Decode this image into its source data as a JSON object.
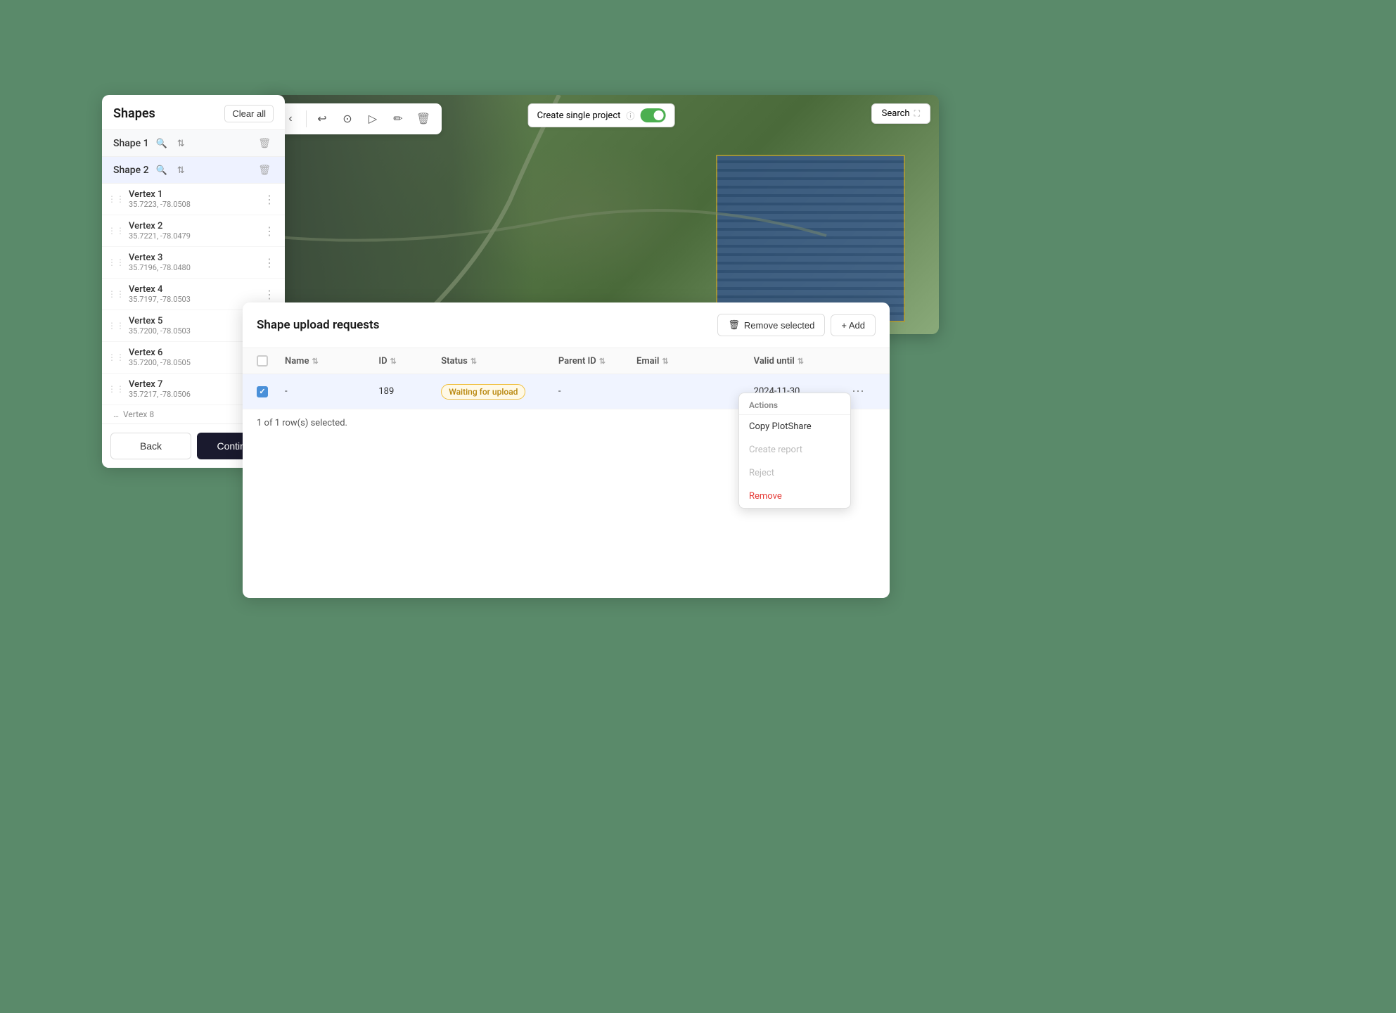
{
  "background": {
    "color": "#5a8a6a"
  },
  "mapPanel": {
    "toolbar": {
      "backLabel": "‹",
      "tools": [
        "↩",
        "⊙",
        "▷",
        "✏",
        "🗑"
      ],
      "createProjectLabel": "Create single project",
      "searchLabel": "Search",
      "expandIcon": "⛶"
    }
  },
  "shapesPanel": {
    "title": "Shapes",
    "clearAllLabel": "Clear all",
    "shapes": [
      {
        "name": "Shape 1",
        "hasZoom": true,
        "hasArrows": true
      },
      {
        "name": "Shape 2",
        "hasZoom": true,
        "hasArrows": true
      }
    ],
    "vertices": [
      {
        "name": "Vertex 1",
        "coords": "35.7223, -78.0508"
      },
      {
        "name": "Vertex 2",
        "coords": "35.7221, -78.0479"
      },
      {
        "name": "Vertex 3",
        "coords": "35.7196, -78.0480"
      },
      {
        "name": "Vertex 4",
        "coords": "35.7197, -78.0503"
      },
      {
        "name": "Vertex 5",
        "coords": "35.7200, -78.0503"
      },
      {
        "name": "Vertex 6",
        "coords": "35.7200, -78.0505"
      },
      {
        "name": "Vertex 7",
        "coords": "35.7217, -78.0506"
      }
    ],
    "moreLabel": "Vertex 8",
    "footer": {
      "backLabel": "Back",
      "continueLabel": "Continue"
    }
  },
  "uploadPanel": {
    "title": "Shape upload requests",
    "removeSelectedLabel": "Remove selected",
    "addLabel": "+ Add",
    "table": {
      "columns": [
        "Name",
        "ID",
        "Status",
        "Parent ID",
        "Email",
        "Valid until"
      ],
      "rows": [
        {
          "name": "-",
          "id": "189",
          "status": "Waiting for upload",
          "parentId": "-",
          "email": "",
          "validUntil": "2024-11-30"
        }
      ]
    },
    "selectedCount": "1 of 1 row(s) selected."
  },
  "contextMenu": {
    "title": "Actions",
    "items": [
      {
        "label": "Copy PlotShare",
        "disabled": false,
        "danger": false
      },
      {
        "label": "Create report",
        "disabled": true,
        "danger": false
      },
      {
        "label": "Reject",
        "disabled": true,
        "danger": false
      },
      {
        "label": "Remove",
        "disabled": false,
        "danger": true
      }
    ]
  }
}
